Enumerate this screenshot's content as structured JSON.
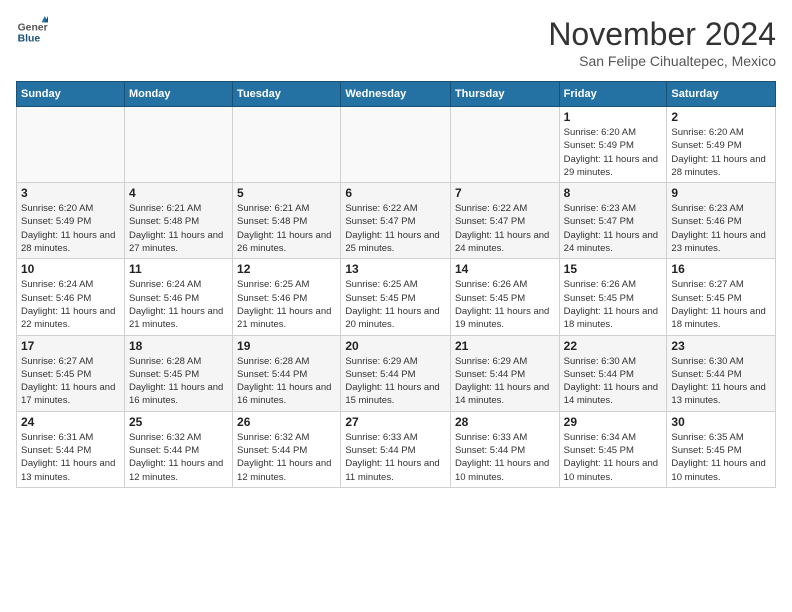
{
  "header": {
    "logo_line1": "General",
    "logo_line2": "Blue",
    "month": "November 2024",
    "location": "San Felipe Cihualtepec, Mexico"
  },
  "days_of_week": [
    "Sunday",
    "Monday",
    "Tuesday",
    "Wednesday",
    "Thursday",
    "Friday",
    "Saturday"
  ],
  "weeks": [
    [
      {
        "day": "",
        "info": ""
      },
      {
        "day": "",
        "info": ""
      },
      {
        "day": "",
        "info": ""
      },
      {
        "day": "",
        "info": ""
      },
      {
        "day": "",
        "info": ""
      },
      {
        "day": "1",
        "info": "Sunrise: 6:20 AM\nSunset: 5:49 PM\nDaylight: 11 hours and 29 minutes."
      },
      {
        "day": "2",
        "info": "Sunrise: 6:20 AM\nSunset: 5:49 PM\nDaylight: 11 hours and 28 minutes."
      }
    ],
    [
      {
        "day": "3",
        "info": "Sunrise: 6:20 AM\nSunset: 5:49 PM\nDaylight: 11 hours and 28 minutes."
      },
      {
        "day": "4",
        "info": "Sunrise: 6:21 AM\nSunset: 5:48 PM\nDaylight: 11 hours and 27 minutes."
      },
      {
        "day": "5",
        "info": "Sunrise: 6:21 AM\nSunset: 5:48 PM\nDaylight: 11 hours and 26 minutes."
      },
      {
        "day": "6",
        "info": "Sunrise: 6:22 AM\nSunset: 5:47 PM\nDaylight: 11 hours and 25 minutes."
      },
      {
        "day": "7",
        "info": "Sunrise: 6:22 AM\nSunset: 5:47 PM\nDaylight: 11 hours and 24 minutes."
      },
      {
        "day": "8",
        "info": "Sunrise: 6:23 AM\nSunset: 5:47 PM\nDaylight: 11 hours and 24 minutes."
      },
      {
        "day": "9",
        "info": "Sunrise: 6:23 AM\nSunset: 5:46 PM\nDaylight: 11 hours and 23 minutes."
      }
    ],
    [
      {
        "day": "10",
        "info": "Sunrise: 6:24 AM\nSunset: 5:46 PM\nDaylight: 11 hours and 22 minutes."
      },
      {
        "day": "11",
        "info": "Sunrise: 6:24 AM\nSunset: 5:46 PM\nDaylight: 11 hours and 21 minutes."
      },
      {
        "day": "12",
        "info": "Sunrise: 6:25 AM\nSunset: 5:46 PM\nDaylight: 11 hours and 21 minutes."
      },
      {
        "day": "13",
        "info": "Sunrise: 6:25 AM\nSunset: 5:45 PM\nDaylight: 11 hours and 20 minutes."
      },
      {
        "day": "14",
        "info": "Sunrise: 6:26 AM\nSunset: 5:45 PM\nDaylight: 11 hours and 19 minutes."
      },
      {
        "day": "15",
        "info": "Sunrise: 6:26 AM\nSunset: 5:45 PM\nDaylight: 11 hours and 18 minutes."
      },
      {
        "day": "16",
        "info": "Sunrise: 6:27 AM\nSunset: 5:45 PM\nDaylight: 11 hours and 18 minutes."
      }
    ],
    [
      {
        "day": "17",
        "info": "Sunrise: 6:27 AM\nSunset: 5:45 PM\nDaylight: 11 hours and 17 minutes."
      },
      {
        "day": "18",
        "info": "Sunrise: 6:28 AM\nSunset: 5:45 PM\nDaylight: 11 hours and 16 minutes."
      },
      {
        "day": "19",
        "info": "Sunrise: 6:28 AM\nSunset: 5:44 PM\nDaylight: 11 hours and 16 minutes."
      },
      {
        "day": "20",
        "info": "Sunrise: 6:29 AM\nSunset: 5:44 PM\nDaylight: 11 hours and 15 minutes."
      },
      {
        "day": "21",
        "info": "Sunrise: 6:29 AM\nSunset: 5:44 PM\nDaylight: 11 hours and 14 minutes."
      },
      {
        "day": "22",
        "info": "Sunrise: 6:30 AM\nSunset: 5:44 PM\nDaylight: 11 hours and 14 minutes."
      },
      {
        "day": "23",
        "info": "Sunrise: 6:30 AM\nSunset: 5:44 PM\nDaylight: 11 hours and 13 minutes."
      }
    ],
    [
      {
        "day": "24",
        "info": "Sunrise: 6:31 AM\nSunset: 5:44 PM\nDaylight: 11 hours and 13 minutes."
      },
      {
        "day": "25",
        "info": "Sunrise: 6:32 AM\nSunset: 5:44 PM\nDaylight: 11 hours and 12 minutes."
      },
      {
        "day": "26",
        "info": "Sunrise: 6:32 AM\nSunset: 5:44 PM\nDaylight: 11 hours and 12 minutes."
      },
      {
        "day": "27",
        "info": "Sunrise: 6:33 AM\nSunset: 5:44 PM\nDaylight: 11 hours and 11 minutes."
      },
      {
        "day": "28",
        "info": "Sunrise: 6:33 AM\nSunset: 5:44 PM\nDaylight: 11 hours and 10 minutes."
      },
      {
        "day": "29",
        "info": "Sunrise: 6:34 AM\nSunset: 5:45 PM\nDaylight: 11 hours and 10 minutes."
      },
      {
        "day": "30",
        "info": "Sunrise: 6:35 AM\nSunset: 5:45 PM\nDaylight: 11 hours and 10 minutes."
      }
    ]
  ]
}
